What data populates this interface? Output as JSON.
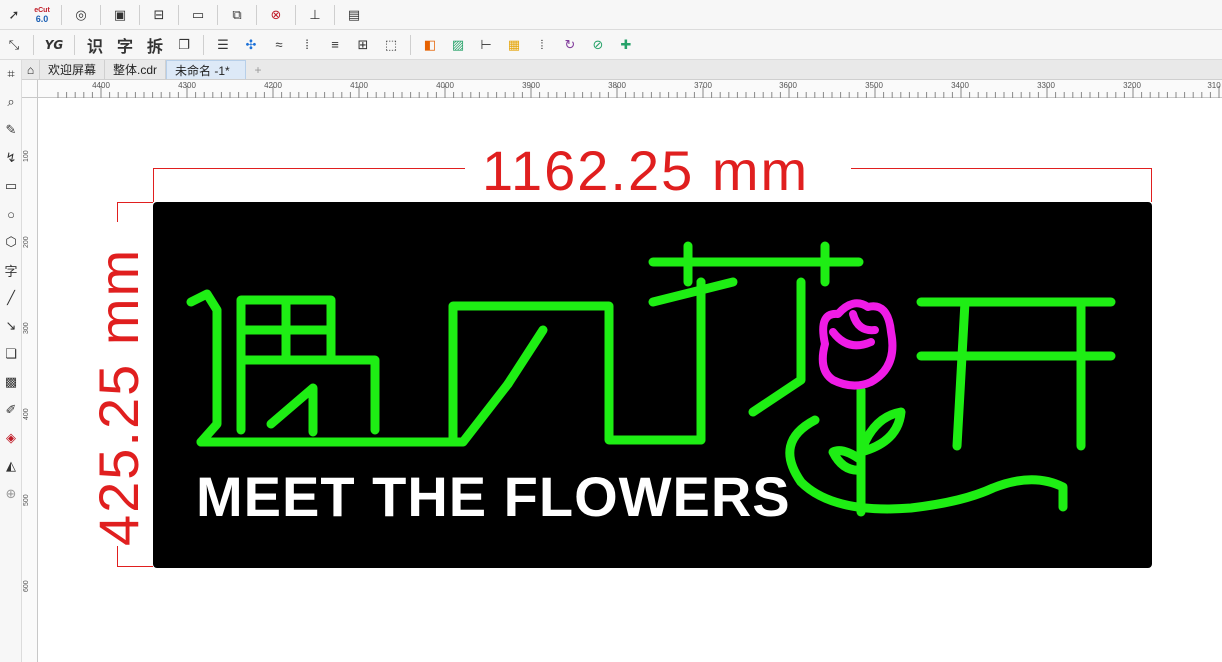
{
  "toolbar": {
    "badge_top": "eCut",
    "badge_version": "6.0",
    "row2_labels": [
      "YG",
      "识",
      "字",
      "拆"
    ]
  },
  "tabs": [
    "欢迎屏幕",
    "整体.cdr",
    "未命名 -1*"
  ],
  "ruler": {
    "horizontal": [
      "4400",
      "4300",
      "4200",
      "4100",
      "4000",
      "3900",
      "3800",
      "3700",
      "3600",
      "3500",
      "3400",
      "3300",
      "3200",
      "310"
    ],
    "vertical": [
      "100",
      "200",
      "300",
      "400",
      "500",
      "600"
    ]
  },
  "canvas": {
    "width_dimension": "1162.25 mm",
    "height_dimension": "425.25 mm",
    "dimension_color": "#e01f1f"
  },
  "sign": {
    "background_color": "#000000",
    "neon_green": "#1eee14",
    "neon_magenta": "#f01ce6",
    "english_text": "MEET THE FLOWERS",
    "english_color": "#ffffff"
  }
}
